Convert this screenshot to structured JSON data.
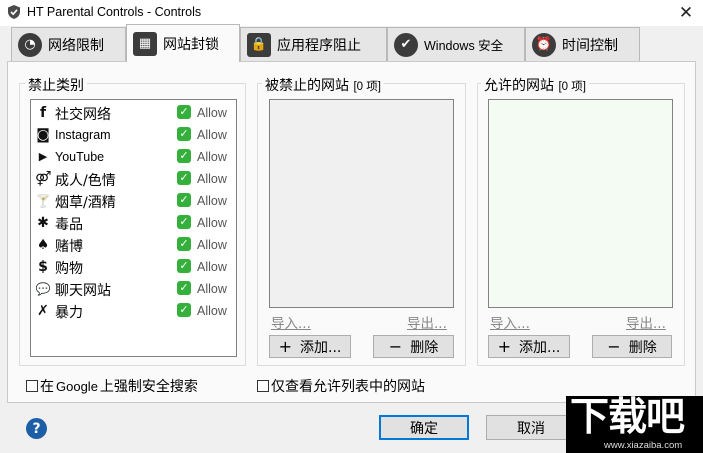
{
  "window": {
    "title": "HT Parental Controls - Controls",
    "close_glyph": "✕"
  },
  "tabs": [
    {
      "label": "网络限制",
      "icon": "gauge-icon",
      "glyph": "◔",
      "active": false
    },
    {
      "label": "网站封锁",
      "icon": "brick-wall-icon",
      "glyph": "▦",
      "active": true
    },
    {
      "label": "应用程序阻止",
      "icon": "app-lock-icon",
      "glyph": "🔒",
      "active": false
    },
    {
      "label": "Windows 安全",
      "icon": "shield-check-icon",
      "glyph": "✔",
      "active": false
    },
    {
      "label": "时间控制",
      "icon": "alarm-clock-icon",
      "glyph": "⏰",
      "active": false
    }
  ],
  "categories": {
    "title": "禁止类别",
    "items": [
      {
        "label": "社交网络",
        "icon": "facebook-icon",
        "glyph": "f",
        "status": "Allow"
      },
      {
        "label": "Instagram",
        "icon": "instagram-icon",
        "glyph": "◙",
        "status": "Allow"
      },
      {
        "label": "YouTube",
        "icon": "youtube-icon",
        "glyph": "▶",
        "status": "Allow"
      },
      {
        "label": "成人/色情",
        "icon": "adult-icon",
        "glyph": "⚤",
        "status": "Allow"
      },
      {
        "label": "烟草/酒精",
        "icon": "cocktail-icon",
        "glyph": "🍸",
        "status": "Allow"
      },
      {
        "label": "毒品",
        "icon": "cannabis-leaf-icon",
        "glyph": "✱",
        "status": "Allow"
      },
      {
        "label": "赌博",
        "icon": "spade-icon",
        "glyph": "♠",
        "status": "Allow"
      },
      {
        "label": "购物",
        "icon": "dollar-icon",
        "glyph": "$",
        "status": "Allow"
      },
      {
        "label": "聊天网站",
        "icon": "chat-bubbles-icon",
        "glyph": "💬",
        "status": "Allow"
      },
      {
        "label": "暴力",
        "icon": "fighter-icon",
        "glyph": "✗",
        "status": "Allow"
      }
    ]
  },
  "blocked_sites": {
    "title": "被禁止的网站",
    "count": "[0 项]",
    "import": "导入...",
    "export": "导出...",
    "add": "添加...",
    "delete": "删除",
    "list_bg": "#f0f0f0"
  },
  "allowed_sites": {
    "title": "允许的网站",
    "count": "[0 项]",
    "import": "导入...",
    "export": "导出...",
    "add": "添加...",
    "delete": "删除",
    "list_bg": "#f4fbf3"
  },
  "options": {
    "safe_search": {
      "pre": "在 ",
      "brand": "Google",
      "post": " 上强制安全搜索",
      "checked": false
    },
    "allow_only": {
      "label": "仅查看允许列表中的网站",
      "checked": false
    }
  },
  "footer": {
    "help_glyph": "?",
    "ok": "确定",
    "cancel": "取消"
  },
  "watermark": {
    "text": "下载吧",
    "url": "www.xiazaiba.com"
  }
}
